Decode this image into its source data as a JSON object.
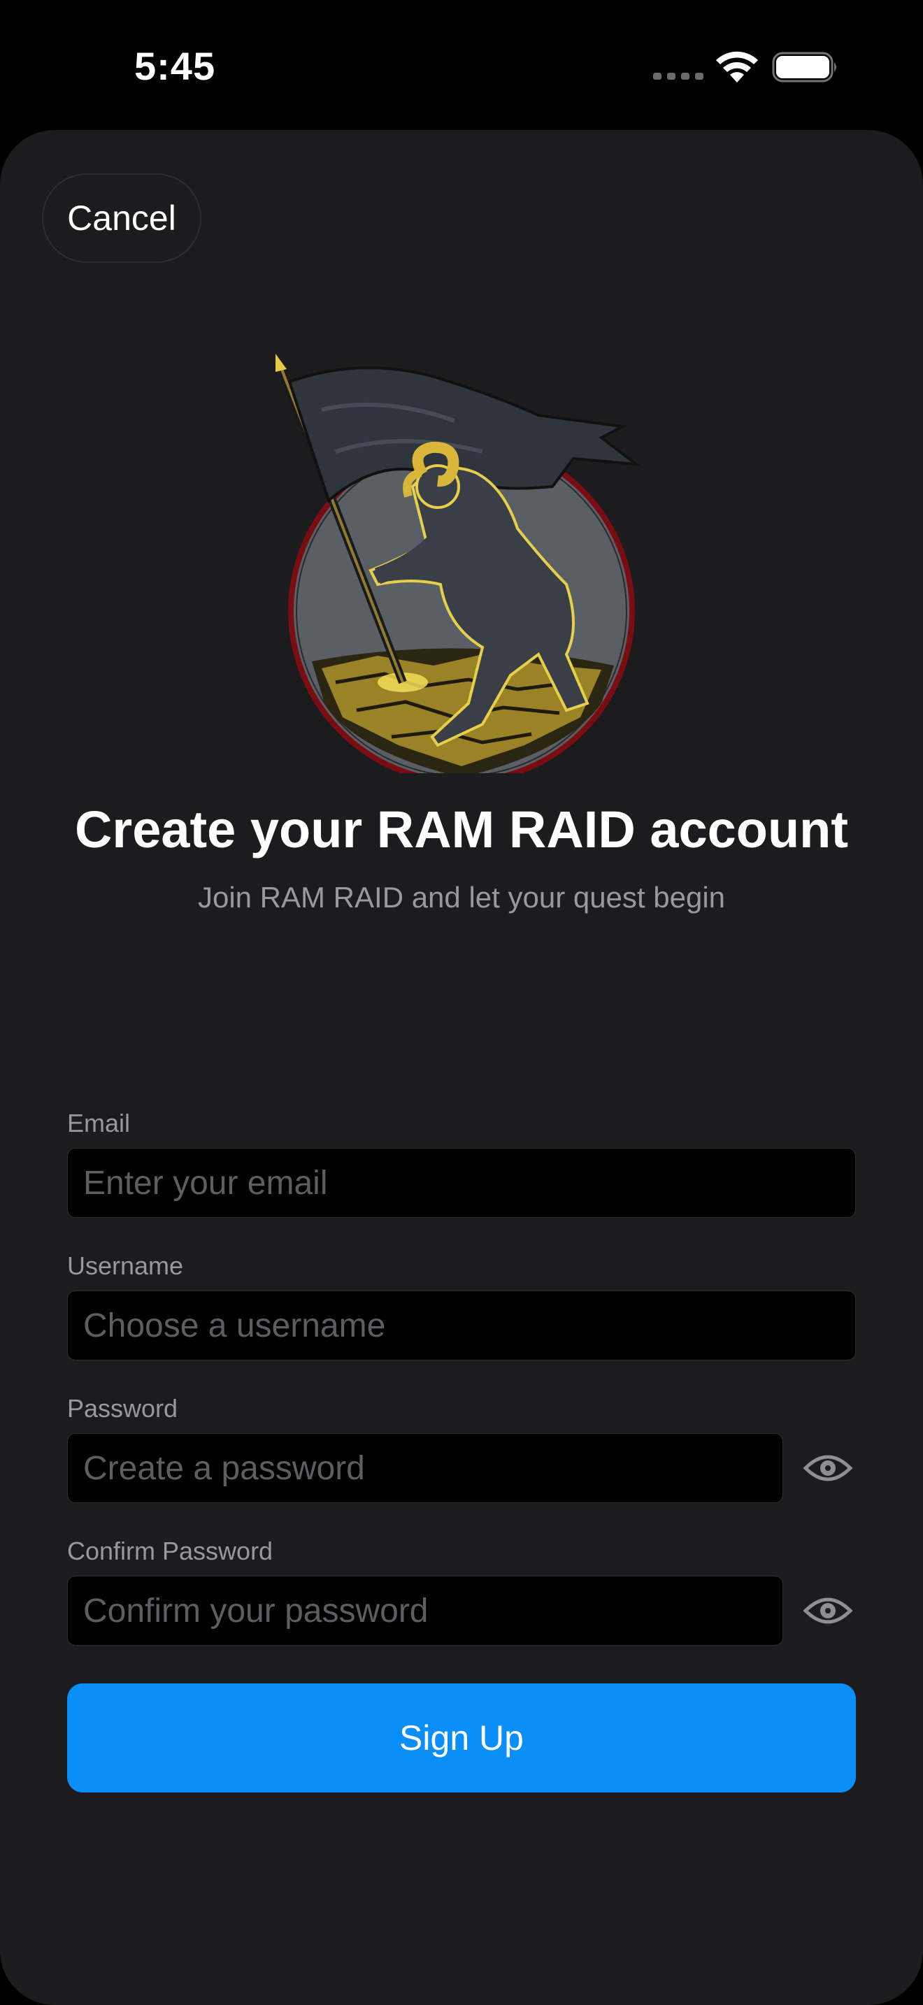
{
  "status_bar": {
    "time": "5:45"
  },
  "header": {
    "cancel_label": "Cancel"
  },
  "main": {
    "title": "Create your RAM RAID account",
    "subtitle": "Join RAM RAID and let your quest begin"
  },
  "form": {
    "email": {
      "label": "Email",
      "placeholder": "Enter your email",
      "value": ""
    },
    "username": {
      "label": "Username",
      "placeholder": "Choose a username",
      "value": ""
    },
    "password": {
      "label": "Password",
      "placeholder": "Create a password",
      "value": ""
    },
    "confirm_password": {
      "label": "Confirm Password",
      "placeholder": "Confirm your password",
      "value": ""
    },
    "submit_label": "Sign Up"
  },
  "icons": {
    "logo": "ram-warrior-flag-logo",
    "password_toggle": "eye-icon",
    "signal": "signal-dots-icon",
    "wifi": "wifi-icon",
    "battery": "battery-icon"
  },
  "colors": {
    "background": "#000000",
    "sheet": "#1c1c1e",
    "primary_button": "#0a8ff9",
    "secondary_text": "#98989e",
    "placeholder_text": "#5d5d62"
  }
}
